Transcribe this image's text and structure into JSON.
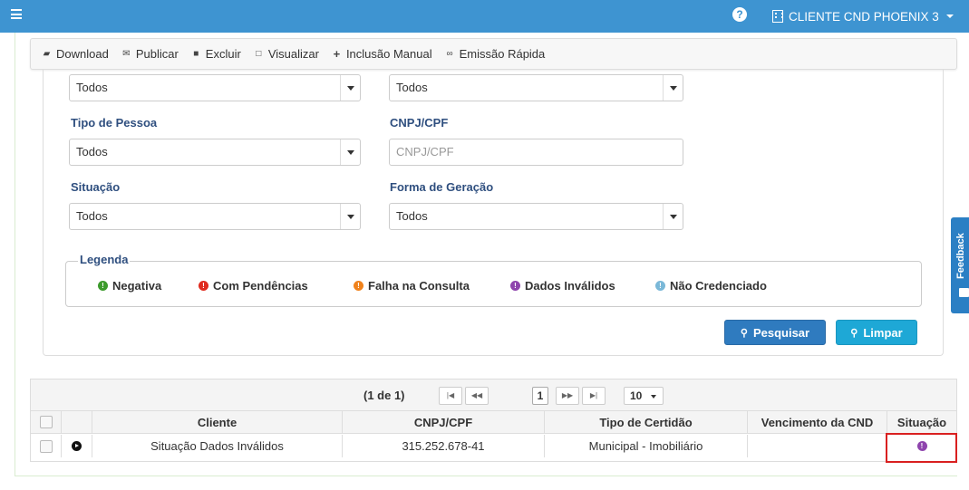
{
  "topbar": {
    "client_name": "CLIENTE CND PHOENIX 3",
    "color": "#3e94d1"
  },
  "toolbar": {
    "items": [
      {
        "icon": "folder-open-icon",
        "label": "Download"
      },
      {
        "icon": "envelope-icon",
        "label": "Publicar"
      },
      {
        "icon": "trash-icon",
        "label": "Excluir"
      },
      {
        "icon": "file-icon",
        "label": "Visualizar"
      },
      {
        "icon": "plus-icon",
        "label": "Inclusão Manual"
      },
      {
        "icon": "link-icon",
        "label": "Emissão Rápida"
      }
    ]
  },
  "filters": {
    "top_left_value": "Todos",
    "top_right_value": "Todos",
    "tipo_pessoa": {
      "label": "Tipo de Pessoa",
      "value": "Todos"
    },
    "cnpj_cpf": {
      "label": "CNPJ/CPF",
      "placeholder": "CNPJ/CPF"
    },
    "situacao": {
      "label": "Situação",
      "value": "Todos"
    },
    "forma_geracao": {
      "label": "Forma de Geração",
      "value": "Todos"
    }
  },
  "legend": {
    "title": "Legenda",
    "items": [
      {
        "label": "Negativa",
        "color": "#3c9a2c"
      },
      {
        "label": "Com Pendências",
        "color": "#e02b1e"
      },
      {
        "label": "Falha na Consulta",
        "color": "#f0821c"
      },
      {
        "label": "Dados Inválidos",
        "color": "#8e44ad"
      },
      {
        "label": "Não Credenciado",
        "color": "#7ab8d8"
      }
    ]
  },
  "buttons": {
    "search": "Pesquisar",
    "clear": "Limpar"
  },
  "feedback": {
    "label": "Feedback"
  },
  "grid": {
    "pager": {
      "page_text": "(1 de 1)",
      "current_page": "1",
      "page_size": "10"
    },
    "columns": [
      "Cliente",
      "CNPJ/CPF",
      "Tipo de Certidão",
      "Vencimento da CND",
      "Situação"
    ],
    "rows": [
      {
        "cliente": "Situação Dados Inválidos",
        "cnpj": "315.252.678-41",
        "tipo": "Municipal - Imobiliário",
        "vencimento": "",
        "situacao_color": "#8e44ad"
      }
    ]
  }
}
